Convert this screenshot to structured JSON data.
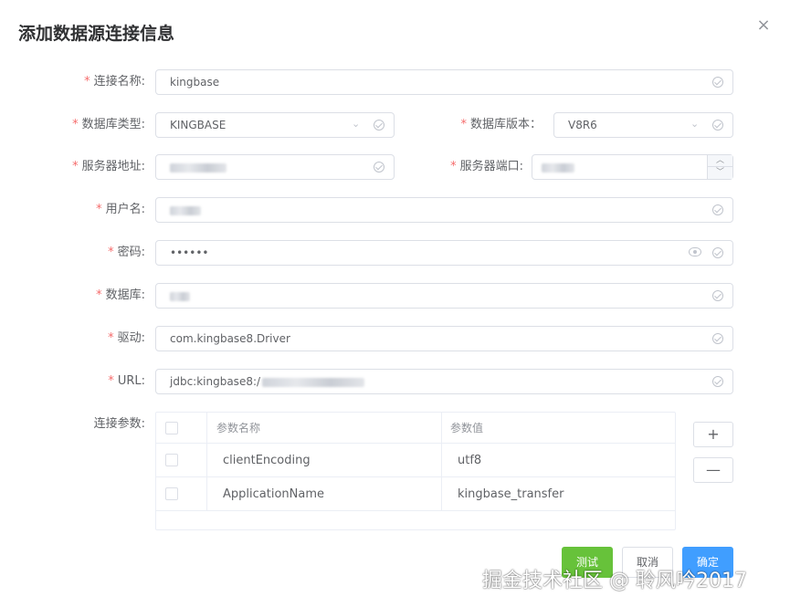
{
  "dialog": {
    "title": "添加数据源连接信息",
    "close_glyph": "×"
  },
  "required_mark": "*",
  "form": {
    "name": {
      "label": "连接名称:",
      "value": "kingbase"
    },
    "db_type": {
      "label": "数据库类型:",
      "value": "KINGBASE"
    },
    "db_version": {
      "label": "数据库版本：",
      "value": "V8R6"
    },
    "host": {
      "label": "服务器地址:"
    },
    "port": {
      "label": "服务器端口:"
    },
    "username": {
      "label": "用户名:"
    },
    "password": {
      "label": "密码:",
      "value": "••••••"
    },
    "database": {
      "label": "数据库:"
    },
    "driver": {
      "label": "驱动:",
      "value": "com.kingbase8.Driver"
    },
    "url": {
      "label": "URL:",
      "value": "jdbc:kingbase8:/"
    },
    "params": {
      "label": "连接参数:",
      "columns": [
        "参数名称",
        "参数值"
      ],
      "rows": [
        {
          "name": "clientEncoding",
          "value": "utf8"
        },
        {
          "name": "ApplicationName",
          "value": "kingbase_transfer"
        }
      ],
      "add_glyph": "+",
      "remove_glyph": "—"
    }
  },
  "footer": {
    "test": "测试",
    "cancel": "取消",
    "confirm": "确定"
  },
  "watermark": "掘金技术社区 @ 聆风吟2017",
  "colors": {
    "required": "#f56c6c",
    "test": "#67c23a",
    "confirm": "#409eff",
    "border": "#dcdfe6"
  }
}
